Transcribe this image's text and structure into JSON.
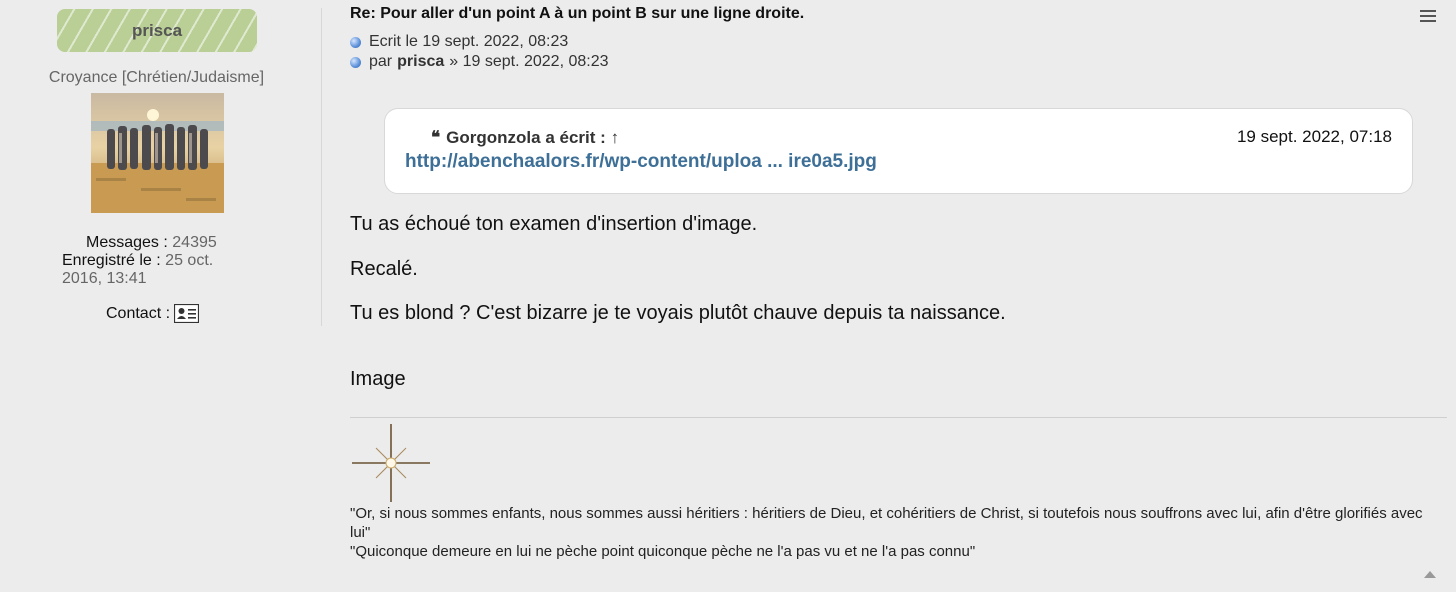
{
  "profile": {
    "username": "prisca",
    "rank": "Croyance [Chrétien/Judaisme]",
    "messages_label": "Messages :",
    "messages_value": "24395",
    "registered_label": "Enregistré le :",
    "registered_value_line1": "25 oct.",
    "registered_value_line2": "2016, 13:41",
    "contact_label": "Contact :"
  },
  "post": {
    "title": "Re: Pour aller d'un point A à un point B sur une ligne droite.",
    "written_line": "Ecrit le 19 sept. 2022, 08:23",
    "by_prefix": "par",
    "author": "prisca",
    "by_suffix": "» 19 sept. 2022, 08:23",
    "quote": {
      "quote_mark": "❝",
      "author": "Gorgonzola",
      "wrote": "a écrit :",
      "arrow": "↑",
      "date": "19 sept. 2022, 07:18",
      "link": "http://abenchaalors.fr/wp-content/uploa ... ire0a5.jpg"
    },
    "paragraphs": [
      "Tu as échoué ton examen d'insertion d'image.",
      "Recalé.",
      "Tu es blond ? C'est bizarre je te voyais plutôt chauve depuis ta naissance.",
      "Image"
    ],
    "signature": [
      "\"Or, si nous sommes enfants, nous sommes aussi héritiers : héritiers de Dieu, et cohéritiers de Christ, si toutefois nous souffrons avec lui, afin d'être glorifiés avec lui\"",
      "\"Quiconque demeure en lui ne pèche point quiconque pèche ne l'a pas vu et ne l'a pas connu\""
    ]
  },
  "colors": {
    "badge": "#b9cf95",
    "link": "#3d6f97",
    "background": "#ececec"
  }
}
